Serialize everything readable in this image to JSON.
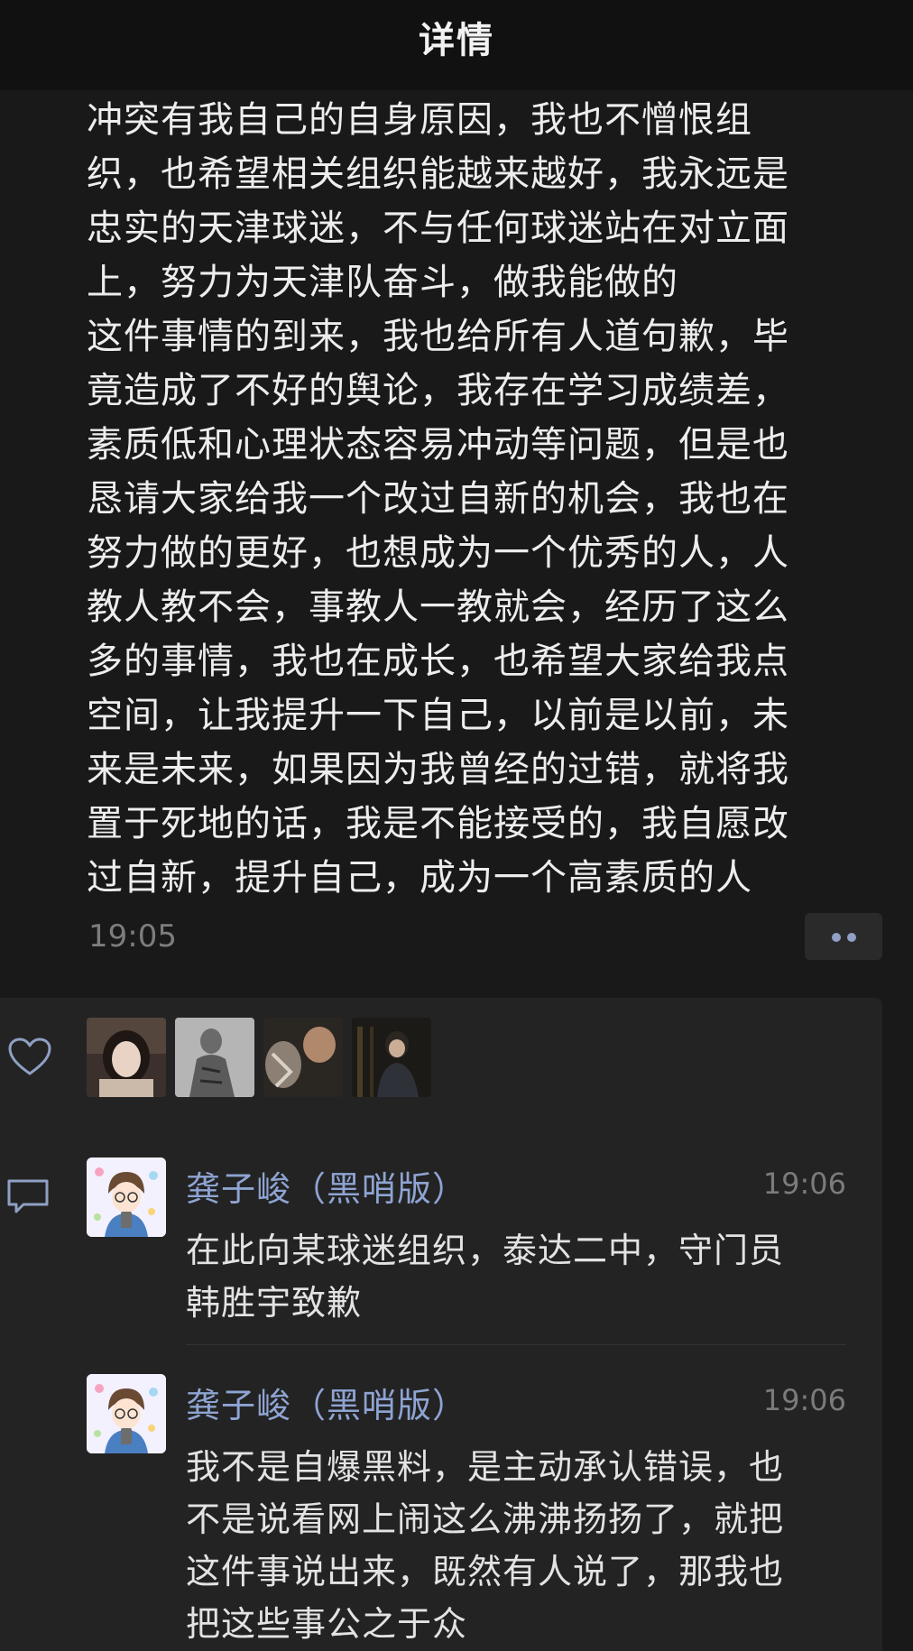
{
  "header": {
    "title": "详情"
  },
  "post": {
    "text_lines": [
      "冲突有我自己的自身原因，我也不憎恨组",
      "织，也希望相关组织能越来越好，我永远是",
      "忠实的天津球迷，不与任何球迷站在对立面",
      "上，努力为天津队奋斗，做我能做的",
      "这件事情的到来，我也给所有人道句歉，毕",
      "竟造成了不好的舆论，我存在学习成绩差，",
      "素质低和心理状态容易冲动等问题，但是也",
      "恳请大家给我一个改过自新的机会，我也在",
      "努力做的更好，也想成为一个优秀的人，人",
      "教人教不会，事教人一教就会，经历了这么",
      "多的事情，我也在成长，也希望大家给我点",
      "空间，让我提升一下自己，以前是以前，未",
      "来是未来，如果因为我曾经的过错，就将我",
      "置于死地的话，我是不能接受的，我自愿改",
      "过自新，提升自己，成为一个高素质的人"
    ],
    "time": "19:05",
    "more_icon": "more-dots-icon"
  },
  "likes": {
    "icon": "heart-icon",
    "avatars": [
      "liker-avatar-1",
      "liker-avatar-2",
      "liker-avatar-3",
      "liker-avatar-4"
    ]
  },
  "comments": {
    "icon": "comment-icon",
    "items": [
      {
        "author": "龚子峻（黑哨版）",
        "time": "19:06",
        "lines": [
          "在此向某球迷组织，泰达二中，守门员",
          "韩胜宇致歉"
        ]
      },
      {
        "author": "龚子峻（黑哨版）",
        "time": "19:06",
        "lines": [
          "我不是自爆黑料，是主动承认错误，也",
          "不是说看网上闹这么沸沸扬扬了，就把",
          "这件事说出来，既然有人说了，那我也",
          "把这些事公之于众"
        ]
      }
    ]
  },
  "colors": {
    "background": "#191919",
    "header": "#111111",
    "panel": "#232323",
    "author_link": "#8ea4d2",
    "muted": "#7d7d7d"
  }
}
